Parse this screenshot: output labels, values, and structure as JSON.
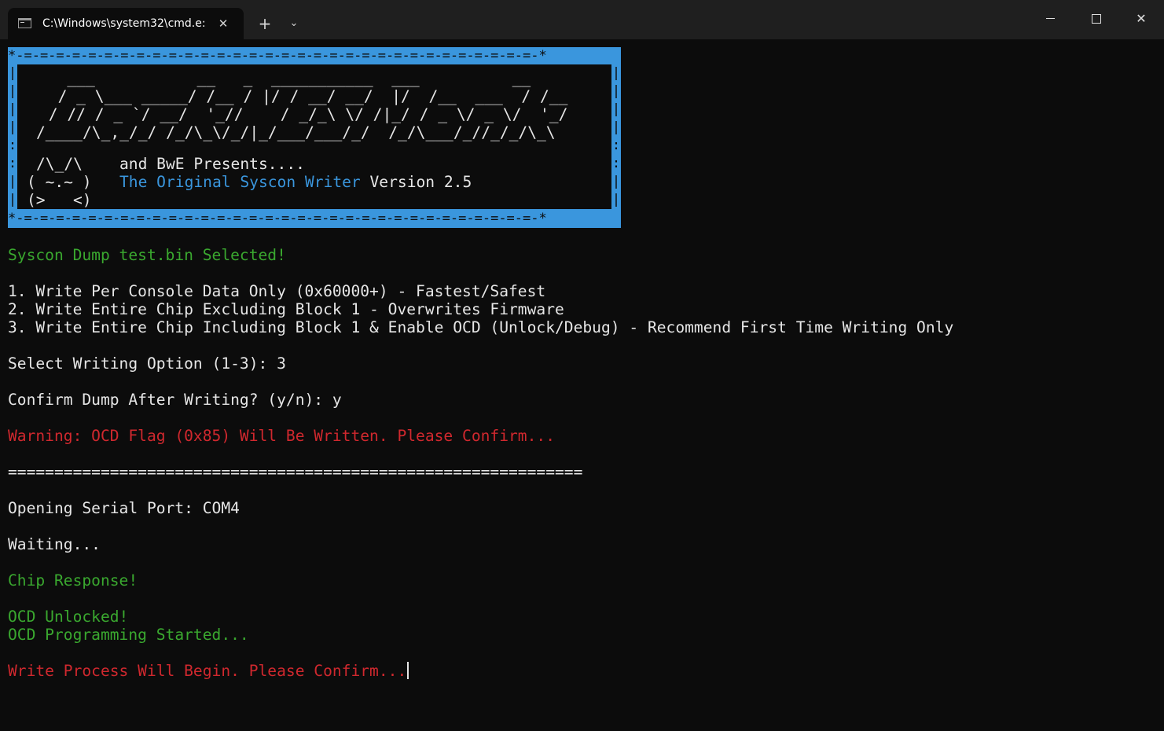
{
  "window": {
    "tab_title": "C:\\Windows\\system32\\cmd.e:",
    "tab_close_glyph": "✕",
    "new_tab_glyph": "+",
    "dropdown_glyph": "⌄",
    "minimize_icon": "minimize-icon",
    "maximize_icon": "maximize-icon",
    "close_glyph": "✕"
  },
  "banner": {
    "top_border": "*-=-=-=-=-=-=-=-=-=-=-=-=-=-=-=-=-=-=-=-=-=-=-=-=-=-=-=-=-=-=-=-=-*",
    "bottom_border": "*-=-=-=-=-=-=-=-=-=-=-=-=-=-=-=-=-=-=-=-=-=-=-=-=-=-=-=-=-=-=-=-=-*",
    "left_side": "|\n|\n|\n|\n:\n:\n|\n|",
    "right_side": "|\n|\n|\n|\n:\n:\n|\n|",
    "art": [
      "   ___           __   _  ___________  ___          __",
      "  / _ \\___ _____/ /__ / |/ / __/ __/  |/  /__  ___  / /__",
      " / // / _ `/ __/  '_//    / _/_\\ \\/ /|_/ / _ \\/ _ \\/  '_/",
      "/____/\\_,_/_/ /_/\\_\\/_/|_/___/___/_/  /_/\\___/_//_/_/\\_\\"
    ],
    "owl_1": "/\\_/\\",
    "owl_2": "( ~.~ )",
    "owl_3": "(>   <)",
    "presents": "and BwE Presents....",
    "product_name": "The Original Syscon Writer",
    "version": " Version 2.5"
  },
  "output": {
    "selected": "Syscon Dump test.bin Selected!",
    "option_1": "1. Write Per Console Data Only (0x60000+) - Fastest/Safest",
    "option_2": "2. Write Entire Chip Excluding Block 1 - Overwrites Firmware",
    "option_3": "3. Write Entire Chip Including Block 1 & Enable OCD (Unlock/Debug) - Recommend First Time Writing Only",
    "select_prompt": "Select Writing Option (1-3): 3",
    "confirm_prompt": "Confirm Dump After Writing? (y/n): y",
    "warning": "Warning: OCD Flag (0x85) Will Be Written. Please Confirm...",
    "separator": "==============================================================",
    "opening_port": "Opening Serial Port: COM4",
    "waiting": "Waiting...",
    "chip_response": "Chip Response!",
    "ocd_unlocked": "OCD Unlocked!",
    "ocd_programming": "OCD Programming Started...",
    "write_confirm": "Write Process Will Begin. Please Confirm..."
  },
  "colors": {
    "background": "#0c0c0c",
    "titlebar": "#1f1f1f",
    "banner": "#3a96dd",
    "green": "#3aa82f",
    "red": "#d0282e",
    "text": "#cccccc"
  }
}
